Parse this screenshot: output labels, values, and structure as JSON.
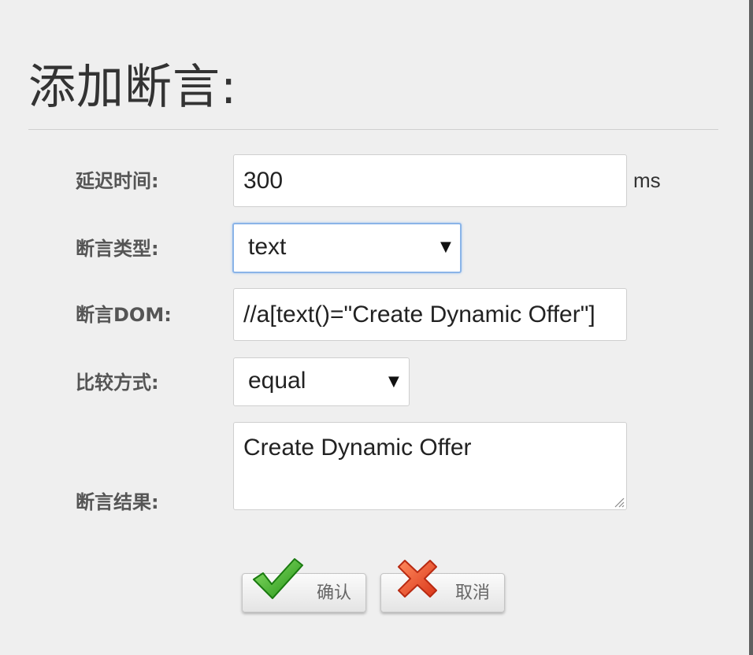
{
  "dialog": {
    "title": "添加断言:"
  },
  "form": {
    "delay": {
      "label": "延迟时间:",
      "value": "300",
      "unit": "ms"
    },
    "assert_type": {
      "label": "断言类型:",
      "value": "text"
    },
    "assert_dom": {
      "label": "断言DOM:",
      "value": "//a[text()=\"Create Dynamic Offer\"]"
    },
    "compare_mode": {
      "label": "比较方式:",
      "value": "equal"
    },
    "assert_result": {
      "label": "断言结果:",
      "value": "Create Dynamic Offer"
    }
  },
  "buttons": {
    "confirm": {
      "label": "确认",
      "icon": "checkmark-icon",
      "color": "#3cb521"
    },
    "cancel": {
      "label": "取消",
      "icon": "cross-icon",
      "color": "#f0522a"
    }
  },
  "icons": {
    "dropdown": "▼"
  }
}
